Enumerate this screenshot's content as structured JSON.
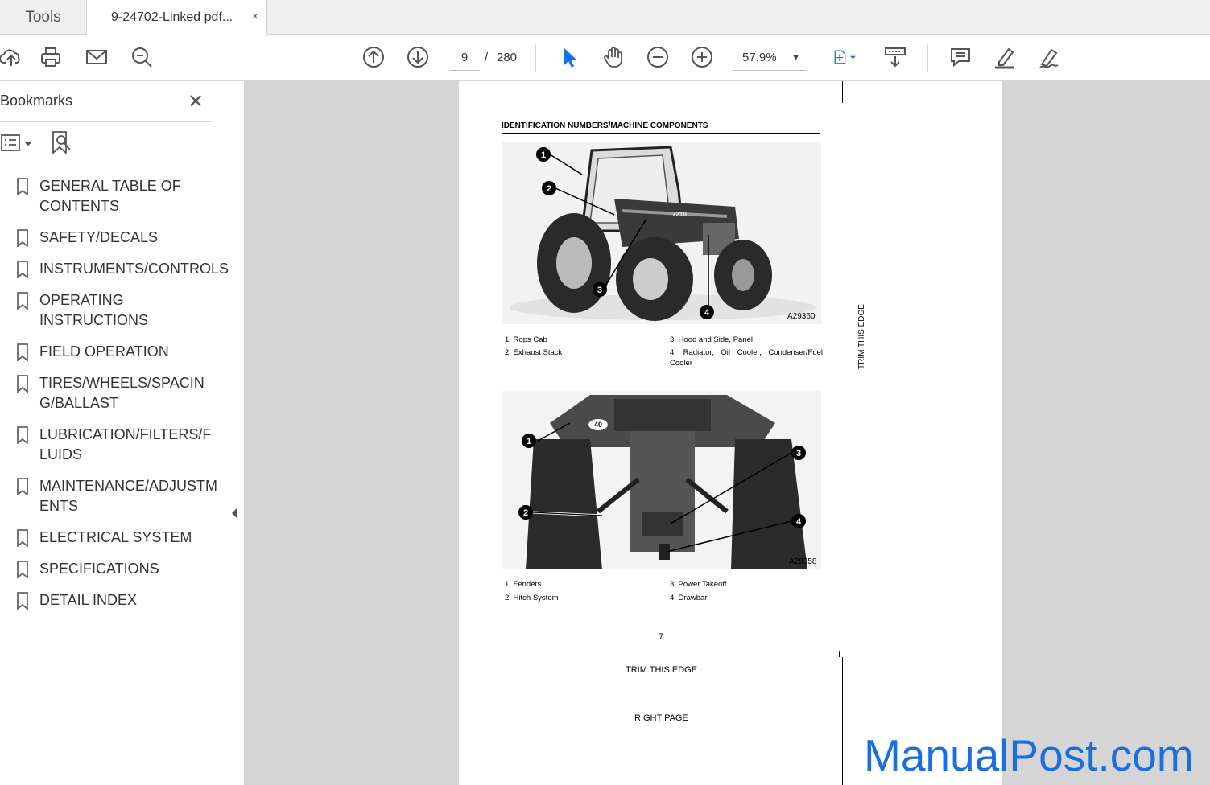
{
  "tabs": {
    "tools_label": "Tools",
    "doc_label": "9-24702-Linked pdf...",
    "close_glyph": "×"
  },
  "toolbar": {
    "current_page": "9",
    "page_separator": "/",
    "total_pages": "280",
    "zoom": "57.9%",
    "icons": [
      "upload-icon",
      "print-icon",
      "mail-icon",
      "find-icon",
      "page-up-icon",
      "page-down-icon",
      "select-arrow-icon",
      "hand-icon",
      "zoom-out-icon",
      "zoom-in-icon",
      "fit-page-icon",
      "scroll-mode-icon",
      "comment-icon",
      "highlight-icon",
      "sign-icon"
    ]
  },
  "sidebar": {
    "title": "Bookmarks",
    "close_glyph": "✕",
    "items": [
      {
        "label": "GENERAL TABLE OF CONTENTS"
      },
      {
        "label": "SAFETY/DECALS"
      },
      {
        "label": "INSTRUMENTS/CONTROLS"
      },
      {
        "label": "OPERATING INSTRUCTIONS"
      },
      {
        "label": "FIELD OPERATION"
      },
      {
        "label": "TIRES/WHEELS/SPACING/BALLAST"
      },
      {
        "label": "LUBRICATION/FILTERS/FLUIDS"
      },
      {
        "label": "MAINTENANCE/ADJUSTMENTS"
      },
      {
        "label": "ELECTRICAL SYSTEM"
      },
      {
        "label": "SPECIFICATIONS"
      },
      {
        "label": "DETAIL INDEX"
      }
    ]
  },
  "document": {
    "heading": "IDENTIFICATION NUMBERS/MACHINE COMPONENTS",
    "figure1": {
      "code": "A29360",
      "model_badge": "7210",
      "callouts": [
        "1",
        "2",
        "3",
        "4"
      ],
      "captions": [
        "1. Rops Cab",
        "2. Exhaust Stack",
        "3. Hood and Side, Panel",
        "4. Radiator, Oil Cooler, Condenser/Fuel Cooler"
      ]
    },
    "figure2": {
      "code": "A29358",
      "badge": "40",
      "callouts": [
        "1",
        "2",
        "3",
        "4"
      ],
      "captions": [
        "1. Fenders",
        "2. Hitch System",
        "3. Power Takeoff",
        "4. Drawbar"
      ]
    },
    "page_number": "7",
    "trim_bottom": "TRIM THIS EDGE",
    "trim_right": "TRIM THIS EDGE",
    "right_page": "RIGHT PAGE"
  },
  "watermark": "ManualPost.com",
  "colors": {
    "accent": "#1473e6",
    "watermark": "#1a6fe0",
    "doc_background": "#d5d5d5"
  }
}
